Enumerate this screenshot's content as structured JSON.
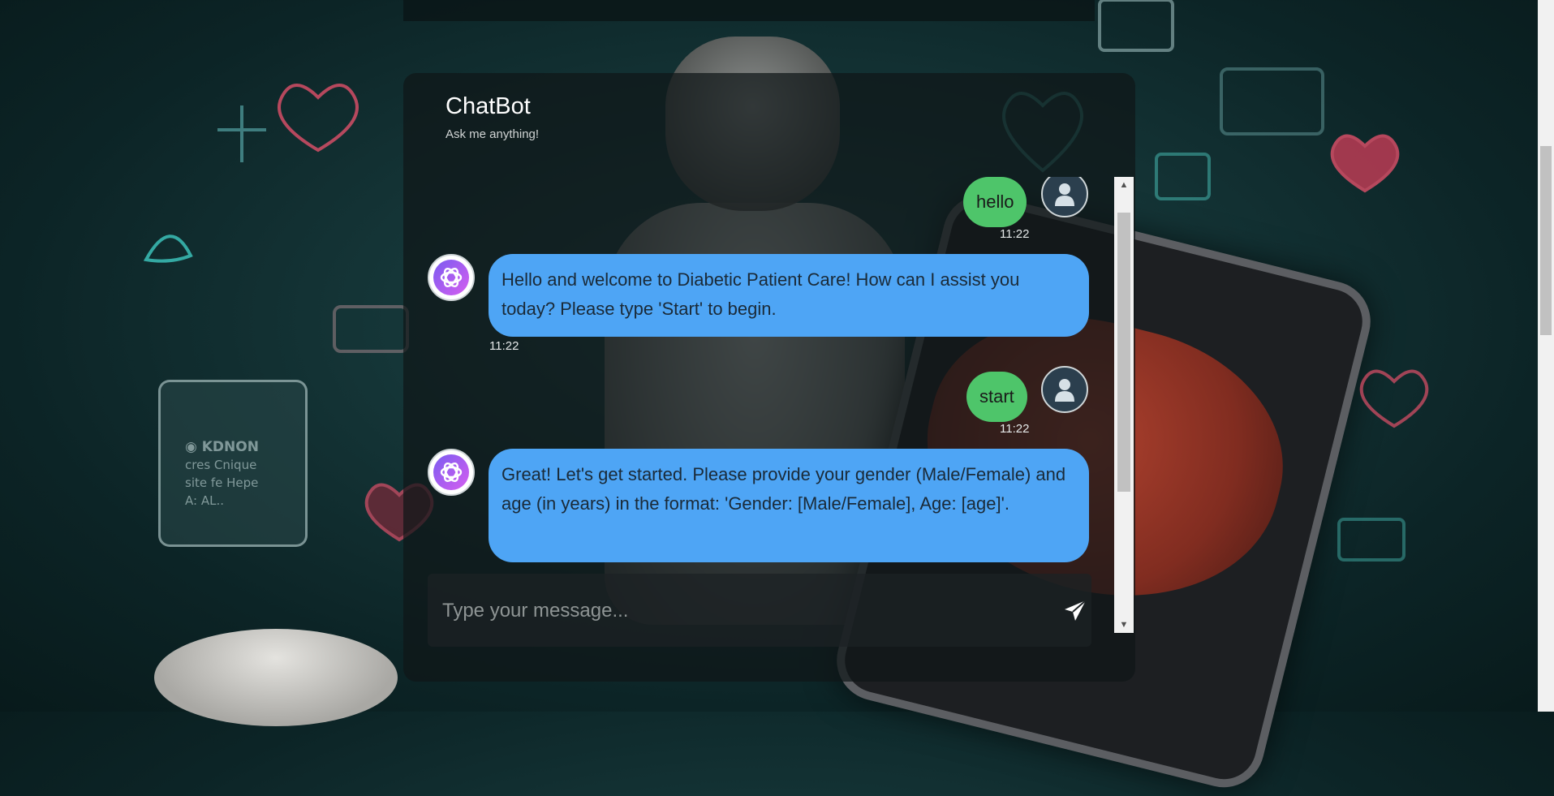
{
  "header": {
    "title": "ChatBot",
    "subtitle": "Ask me anything!"
  },
  "messages": [
    {
      "sender": "user",
      "text": "hello",
      "time": "11:22"
    },
    {
      "sender": "bot",
      "text": "Hello and welcome to Diabetic Patient Care! How can I assist you today? Please type 'Start' to begin.",
      "time": "11:22"
    },
    {
      "sender": "user",
      "text": "start",
      "time": "11:22"
    },
    {
      "sender": "bot",
      "text": "Great! Let's get started. Please provide your gender (Male/Female) and age (in years) in the format: 'Gender: [Male/Female], Age: [age]'.",
      "time": ""
    }
  ],
  "input": {
    "placeholder": "Type your message...",
    "value": ""
  },
  "icons": {
    "send": "send-icon",
    "user_avatar": "user-avatar-icon",
    "bot_avatar": "bot-avatar-icon"
  },
  "colors": {
    "user_bubble": "#4ec56a",
    "bot_bubble": "#4ea5f5",
    "panel": "#0f1618"
  }
}
